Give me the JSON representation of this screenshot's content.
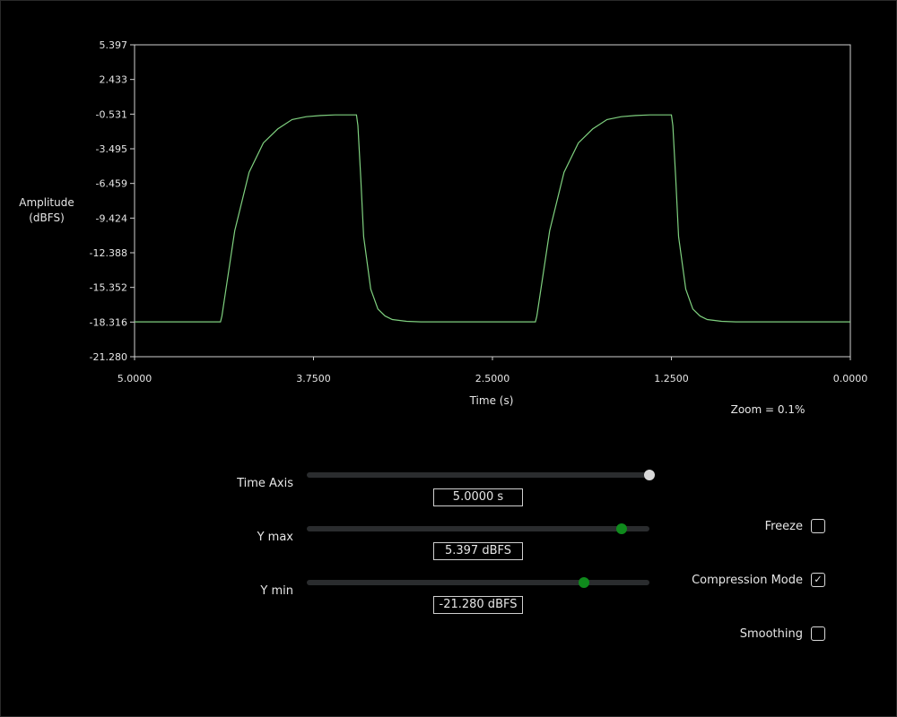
{
  "scope": {
    "y_axis_label_line1": "Amplitude",
    "y_axis_label_line2": "(dBFS)",
    "x_axis_label": "Time (s)",
    "zoom_text": "Zoom = 0.1%",
    "trace_color": "#7fd07f"
  },
  "chart_data": {
    "type": "line",
    "title": "",
    "xlabel": "Time (s)",
    "ylabel": "Amplitude (dBFS)",
    "x_ticks": [
      "5.0000",
      "3.7500",
      "2.5000",
      "1.2500",
      "0.0000"
    ],
    "y_ticks": [
      "5.397",
      "2.433",
      "-0.531",
      "-3.495",
      "-6.459",
      "-9.424",
      "-12.388",
      "-15.352",
      "-18.316",
      "-21.280"
    ],
    "xlim": [
      5.0,
      0.0
    ],
    "ylim": [
      -21.28,
      5.397
    ],
    "x_reversed": true,
    "grid": false,
    "series": [
      {
        "x": [
          5.0,
          4.4,
          4.39,
          4.3,
          4.2,
          4.1,
          4.0,
          3.9,
          3.8,
          3.7,
          3.6,
          3.5,
          3.45,
          3.44,
          3.42,
          3.4,
          3.35,
          3.3,
          3.25,
          3.2,
          3.1,
          3.0,
          2.9,
          2.8,
          2.2,
          2.19,
          2.1,
          2.0,
          1.9,
          1.8,
          1.7,
          1.6,
          1.5,
          1.4,
          1.3,
          1.25,
          1.24,
          1.22,
          1.2,
          1.15,
          1.1,
          1.05,
          1.0,
          0.9,
          0.8,
          0.7,
          0.6,
          0.0
        ],
        "y": [
          -18.3,
          -18.3,
          -17.8,
          -10.5,
          -5.5,
          -3.0,
          -1.8,
          -1.0,
          -0.75,
          -0.65,
          -0.6,
          -0.6,
          -0.6,
          -1.5,
          -6.0,
          -11.0,
          -15.5,
          -17.2,
          -17.8,
          -18.1,
          -18.25,
          -18.3,
          -18.3,
          -18.3,
          -18.3,
          -17.8,
          -10.5,
          -5.5,
          -3.0,
          -1.8,
          -1.0,
          -0.75,
          -0.65,
          -0.6,
          -0.6,
          -0.6,
          -1.5,
          -6.0,
          -11.0,
          -15.5,
          -17.2,
          -17.8,
          -18.1,
          -18.25,
          -18.3,
          -18.3,
          -18.3,
          -18.3
        ]
      }
    ]
  },
  "controls": {
    "time_axis": {
      "label": "Time Axis",
      "value_text": "5.0000 s",
      "fraction": 1.0
    },
    "y_max": {
      "label": "Y max",
      "value_text": "5.397 dBFS",
      "fraction": 0.92
    },
    "y_min": {
      "label": "Y min",
      "value_text": "-21.280 dBFS",
      "fraction": 0.81
    }
  },
  "options": {
    "freeze": {
      "label": "Freeze",
      "checked": false
    },
    "compression_mode": {
      "label": "Compression Mode",
      "checked": true
    },
    "smoothing": {
      "label": "Smoothing",
      "checked": false
    }
  }
}
